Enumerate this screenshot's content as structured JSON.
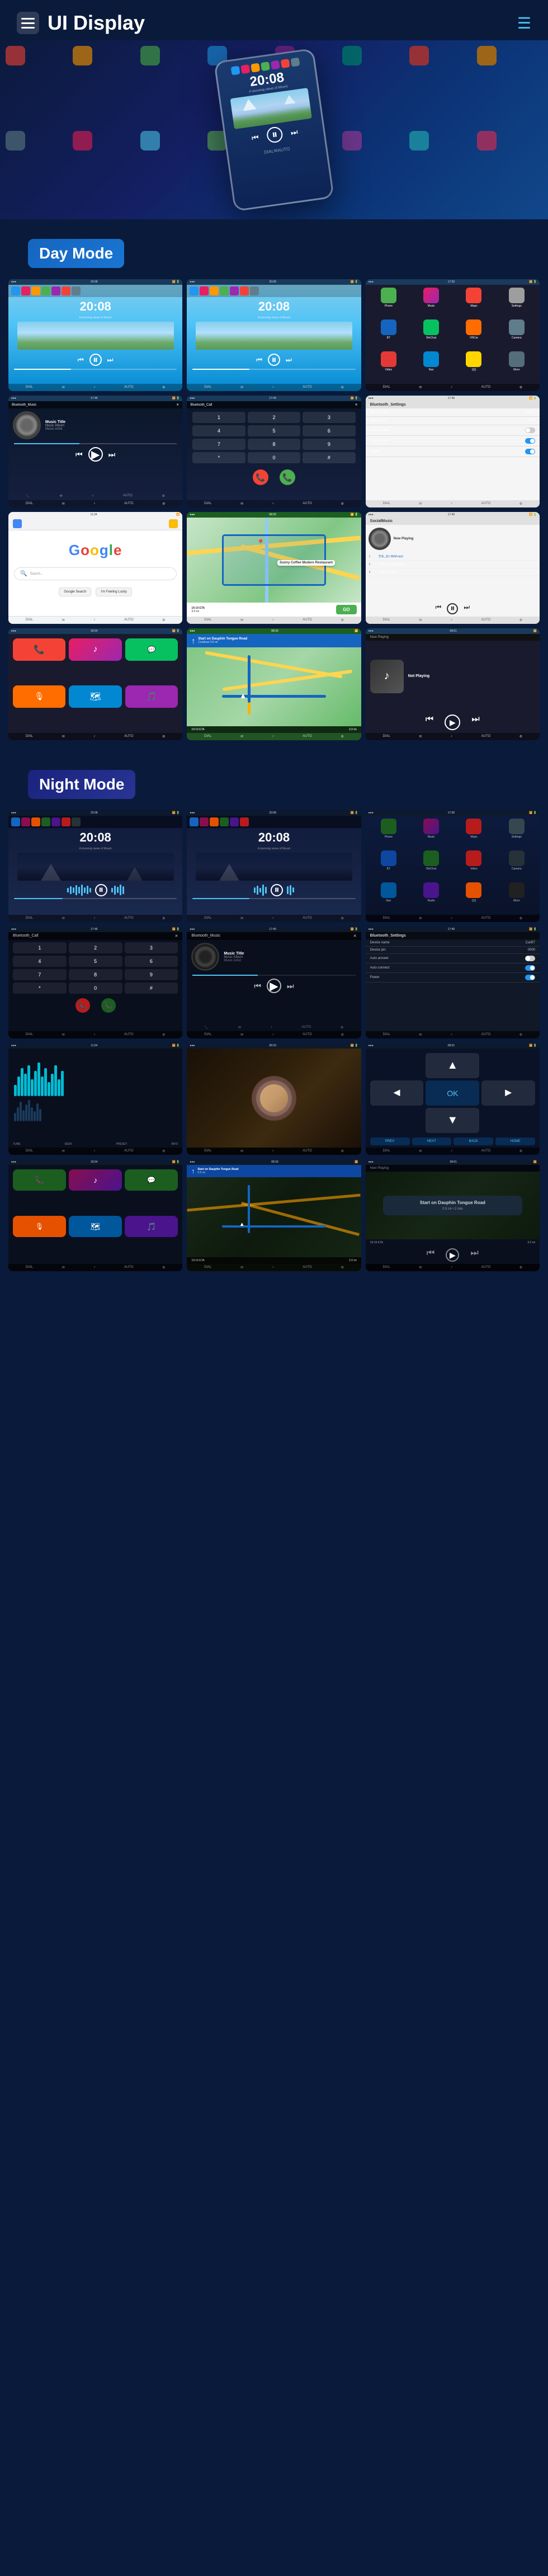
{
  "header": {
    "title": "UI Display",
    "menu_icon": "≡",
    "nav_icon": "≡"
  },
  "day_mode": {
    "label": "Day Mode"
  },
  "night_mode": {
    "label": "Night Mode"
  },
  "screens": {
    "time": "20:08",
    "location": "A stunning views of Mount",
    "music_title": "Music Title",
    "music_album": "Music Album",
    "music_artist": "Music Artist",
    "bluetooth_music": "Bluetooth_Music",
    "bluetooth_call": "Bluetooth_Call",
    "bluetooth_settings": "Bluetooth_Settings",
    "device_name_label": "Device name",
    "device_name_value": "CarBT",
    "device_pin_label": "Device pin",
    "device_pin_value": "0000",
    "auto_answer_label": "Auto answer",
    "auto_connect_label": "Auto connect",
    "power_label": "Power",
    "google_text": "Google",
    "sunny_coffee": "Sunny Coffee Modern Restaurant",
    "sunny_address": "Modern Restaurant",
    "eta": "19:19 ETA",
    "distance": "3.0 mi",
    "go_button": "GO",
    "now_playing": "Not Playing",
    "social_music": "SocialMusic",
    "nav_start": "Start on Dauphin Tongue Road",
    "song1": "华东_云1.REM.mp3",
    "song2": "华东_云2.REM.mp3",
    "song3": "华东_云3.mp3",
    "night_song_title": "Music Title",
    "night_album": "Music Album",
    "night_artist": "Music Artist"
  }
}
